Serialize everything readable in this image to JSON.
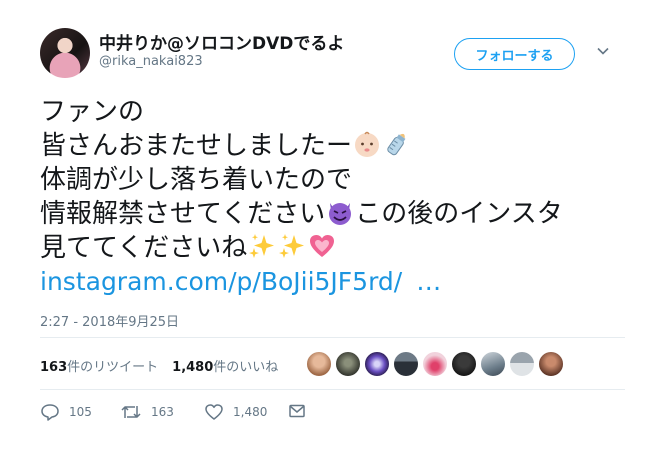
{
  "user": {
    "display_name": "中井りか@ソロコンDVDでるよ",
    "handle": "@rika_nakai823"
  },
  "follow_button": {
    "label": "フォローする"
  },
  "tweet": {
    "lines": [
      "ファンの",
      "皆さんおまたせしましたー",
      "体調が少し落ち着いたので",
      "情報解禁させてください",
      "この後のインスタ",
      "見ててくださいね"
    ],
    "link": "instagram.com/p/BoJii5JF5rd/",
    "link_ellipsis": "…"
  },
  "timestamp": "2:27 - 2018年9月25日",
  "stats": {
    "retweets_count": "163",
    "retweets_label": "件のリツイート",
    "likes_count": "1,480",
    "likes_label": "件のいいね"
  },
  "actions": {
    "reply_count": "105",
    "retweet_count": "163",
    "like_count": "1,480"
  },
  "icons": [
    "chevron-down-icon",
    "baby-emoji",
    "baby-bottle-emoji",
    "smiling-devil-emoji",
    "sparkles-emoji",
    "growing-heart-emoji",
    "reply-icon",
    "retweet-icon",
    "heart-icon",
    "message-icon"
  ],
  "colors": {
    "accent": "#1da1f2",
    "link": "#1b95e0",
    "muted": "#657786",
    "text": "#14171a"
  }
}
